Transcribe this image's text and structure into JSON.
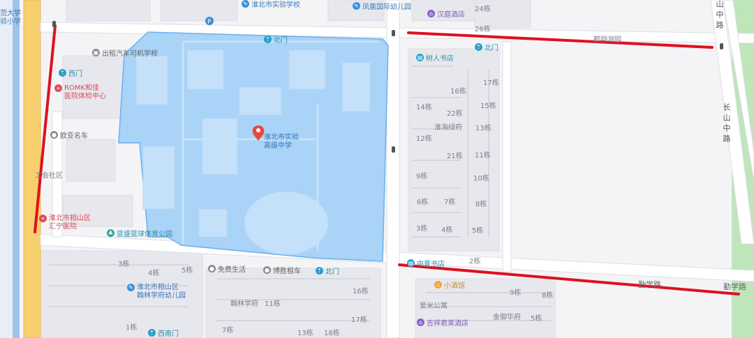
{
  "map": {
    "colors": {
      "background": "#f4f4f6",
      "school_area": "#a9d3f7",
      "school_border": "#6bb0ee",
      "red_route": "#e0101e",
      "arterial_road": "#f7cf6f",
      "canal": "#9fc3ea",
      "park": "#a5dca0"
    },
    "school": {
      "name_line1": "淮北市实验",
      "name_line2": "高级中学",
      "north_gate": "北门",
      "pin_icon": "red-location-pin"
    },
    "pois": [
      {
        "id": "huaibei-experimental-school",
        "name": "淮北市实验学校",
        "icon": "school-icon"
      },
      {
        "id": "fenghuang-kindergarten",
        "name": "凤凰国际幼儿园",
        "icon": "school-icon"
      },
      {
        "id": "hanting-hotel",
        "name": "汉庭酒店",
        "icon": "hotel-icon"
      },
      {
        "id": "taxi-driving-school",
        "name": "出租汽车司机学校",
        "icon": "school-icon"
      },
      {
        "id": "west-gate",
        "name": "西门",
        "icon": "gate-icon"
      },
      {
        "id": "romk-clinic",
        "name": "ROMK和佳医院体检中心",
        "name_line1": "ROMK和佳",
        "name_line2": "医院体检中心",
        "icon": "hospital-icon"
      },
      {
        "id": "ouya-cars",
        "name": "欧亚名车",
        "icon": "car-icon"
      },
      {
        "id": "huining-hospital",
        "name_line1": "淮北市相山区",
        "name_line2": "汇宁医院",
        "icon": "hospital-icon"
      },
      {
        "id": "park",
        "name": "篮盛篮球体育公园",
        "icon": "park-icon"
      },
      {
        "id": "shuren-bookstore",
        "name": "树人书店",
        "icon": "bookstore-icon"
      },
      {
        "id": "north-gate-east",
        "name": "北门",
        "icon": "gate-icon"
      },
      {
        "id": "zhongxuan-bookstore",
        "name": "中萱书店",
        "icon": "bookstore-icon"
      },
      {
        "id": "xiaojiuguan",
        "name": "小酒馆",
        "icon": "bar-icon"
      },
      {
        "id": "jixiang-hotel",
        "name": "吉祥君莱酒店",
        "icon": "hotel-icon"
      },
      {
        "id": "mianfei",
        "name": "免费生活",
        "icon": "shop-icon"
      },
      {
        "id": "bosheng-car",
        "name": "博胜租车",
        "icon": "car-icon"
      },
      {
        "id": "north-gate-south",
        "name": "北门",
        "icon": "gate-icon"
      },
      {
        "id": "hanlin-kindergarten",
        "name_line1": "淮北市相山区",
        "name_line2": "翰林学府幼儿园",
        "icon": "school-icon"
      },
      {
        "id": "south-west-gate",
        "name": "西南门",
        "icon": "gate-icon"
      }
    ],
    "areas": {
      "gongsan": "工会社区",
      "huaihai": "淮海绿府",
      "hanlin": "翰林学府",
      "aimi": "爱米公寓",
      "jinyu": "金御华府",
      "hefeng": "鹤翔测园",
      "top_left": "范大学",
      "top_left2": "验小学"
    },
    "roads": {
      "changshan_top": "山中路",
      "changshan_mid": "长山中路",
      "qinxue1": "勤学路",
      "qinxue2": "勤学路",
      "hefeng_road": "鹤翔测园"
    },
    "buildings": {
      "east_block": [
        "24栋",
        "26栋",
        "17栋",
        "16栋",
        "14栋",
        "15栋",
        "22栋",
        "13栋",
        "12栋",
        "21栋",
        "11栋",
        "9栋",
        "10栋",
        "6栋",
        "7栋",
        "8栋",
        "3栋",
        "4栋",
        "5栋",
        "2栋"
      ],
      "southeast_block": [
        "9栋",
        "8栋",
        "5栋"
      ],
      "south_block": [
        "3栋",
        "4栋",
        "5栋",
        "16栋",
        "11栋",
        "17栋",
        "1栋",
        "7栋",
        "13栋",
        "18栋"
      ]
    }
  }
}
